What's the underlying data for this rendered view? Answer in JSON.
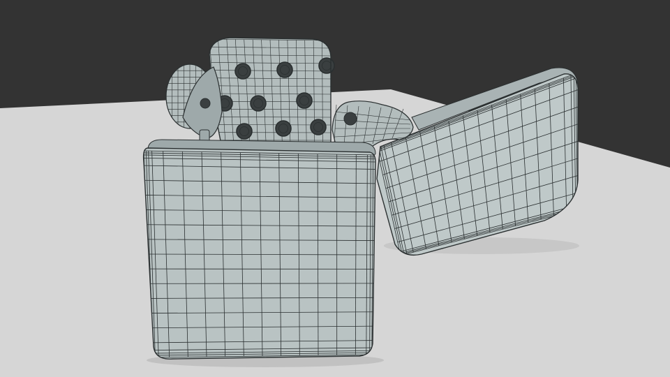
{
  "scene": {
    "subject": "lighter-wireframe-render",
    "colors": {
      "background": "#333333",
      "floor": "#d6d6d6",
      "floor_far": "#c9c9c9",
      "body_fill": "#b9c3c3",
      "body_fill_dark": "#9ea9aa",
      "chimney_fill": "#b3bdbd",
      "lid_fill": "#bfc9c9",
      "lid_inner": "#a9b3b4",
      "wire": "#2a2f30",
      "hole": "#3a3f40",
      "shadow": "#9a9a9a"
    },
    "mesh": {
      "body_columns": 12,
      "body_rows": 14,
      "chimney_columns": 14,
      "chimney_rows": 14,
      "lid_columns": 14,
      "lid_rows": 8
    },
    "chimney_hole_count": 9
  }
}
